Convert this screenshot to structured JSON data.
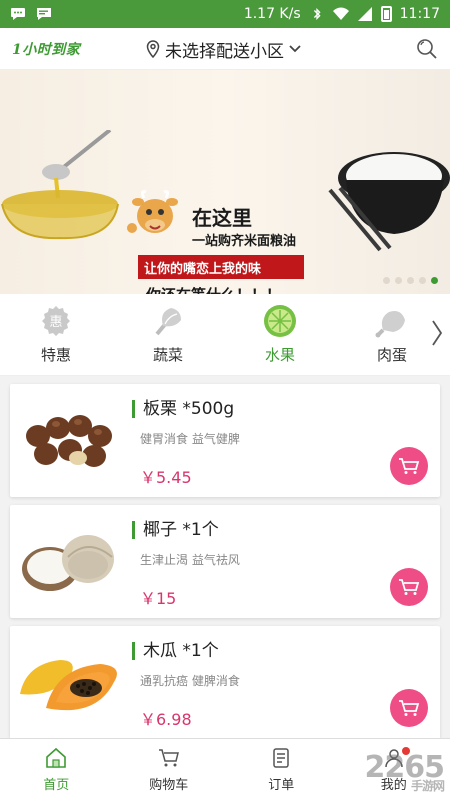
{
  "status_bar": {
    "speed": "1.17 K/s",
    "time": "11:17"
  },
  "header": {
    "logo": "1小时到家",
    "location": "未选择配送小区"
  },
  "banner": {
    "line1": "在这里",
    "line2": "一站购齐米面粮油",
    "line3": "让你的嘴恋上我的味",
    "line4": "你还在等什么！！！",
    "slides": 5,
    "active_slide": 5
  },
  "categories": [
    {
      "label": "特惠",
      "icon": "discount-icon",
      "active": false
    },
    {
      "label": "蔬菜",
      "icon": "vegetable-icon",
      "active": false
    },
    {
      "label": "水果",
      "icon": "fruit-icon",
      "active": true
    },
    {
      "label": "肉蛋",
      "icon": "meat-icon",
      "active": false
    }
  ],
  "products": [
    {
      "name": "板栗 *500g",
      "desc": "健胃消食 益气健脾",
      "price": "￥5.45",
      "image": "chestnut-image"
    },
    {
      "name": "椰子 *1个",
      "desc": "生津止渴 益气祛风",
      "price": "￥15",
      "image": "coconut-image"
    },
    {
      "name": "木瓜 *1个",
      "desc": "通乳抗癌 健脾消食",
      "price": "￥6.98",
      "image": "papaya-image"
    }
  ],
  "bottom_nav": [
    {
      "label": "首页",
      "icon": "home-icon",
      "active": true
    },
    {
      "label": "购物车",
      "icon": "cart-icon",
      "active": false
    },
    {
      "label": "订单",
      "icon": "order-icon",
      "active": false
    },
    {
      "label": "我的",
      "icon": "user-icon",
      "active": false
    }
  ],
  "watermark": {
    "main": "2265",
    "sub": "手游网"
  },
  "colors": {
    "brand_green": "#3e9b33",
    "status_green": "#4a9a3c",
    "price_pink": "#d9366b",
    "cart_pink": "#ef4d86"
  }
}
